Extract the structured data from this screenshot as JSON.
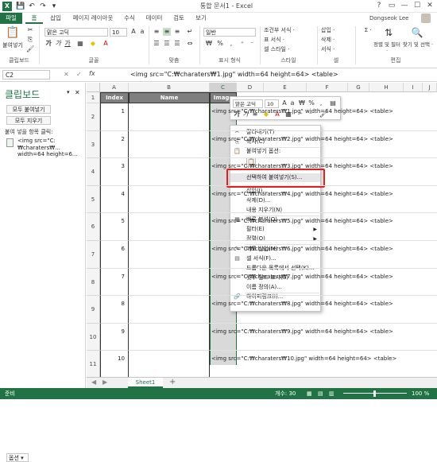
{
  "titlebar": {
    "app_icon": "X",
    "title": "통합 문서1 - Excel",
    "qat": [
      "save-icon",
      "undo-icon",
      "redo-icon",
      "customize-icon"
    ],
    "win": [
      "?",
      "▭",
      "—",
      "☐",
      "✕"
    ]
  },
  "tabs": [
    "파일",
    "홈",
    "삽입",
    "페이지 레이아웃",
    "수식",
    "데이터",
    "검토",
    "보기"
  ],
  "user": "Dongseok Lee",
  "ribbon": {
    "clipboard": {
      "paste": "붙여넣기",
      "label": "클립보드"
    },
    "font": {
      "name": "맑은 고딕",
      "size": "10",
      "label": "글꼴",
      "bold": "가",
      "italic": "가",
      "underline": "가"
    },
    "align": {
      "label": "맞춤"
    },
    "number": {
      "format": "일반",
      "label": "표시 형식",
      "percent": "%",
      "comma": ","
    },
    "style": {
      "cond": "조건부 서식 ·",
      "table": "표 서식 ·",
      "cell": "셀 스타일 ·",
      "label": "스타일"
    },
    "cells": {
      "insert": "삽입 ·",
      "delete": "삭제 ·",
      "format": "서식 ·",
      "label": "셀"
    },
    "edit": {
      "sum": "Σ ·",
      "sort": "정렬 및 필터 ·",
      "find": "찾기 및 선택 ·",
      "label": "편집"
    }
  },
  "formulabar": {
    "namebox": "C2",
    "fx": "fx",
    "text": "<img src=\"C:₩charaters₩1.jpg\" width=64 height=64> <table>"
  },
  "clipboard_pane": {
    "title": "클립보드",
    "paste_all": "모두 붙여넣기",
    "clear_all": "모두 지우기",
    "hint": "붙여 넣을 항목 클릭:",
    "item": "<img src=\"C:₩charaters₩... width=64 height=6...",
    "options": "옵션 ▾"
  },
  "grid": {
    "columns": [
      "A",
      "B",
      "C",
      "D",
      "E",
      "F",
      "G",
      "H",
      "I",
      "J"
    ],
    "header": {
      "index": "Index",
      "name": "Name",
      "image": "Image"
    },
    "rows": [
      {
        "row": "1"
      },
      {
        "row": "2",
        "index": "1",
        "text": "<img src=\"C:₩charaters₩1.jpg\" width=64 height=64> <table>"
      },
      {
        "row": "3",
        "index": "2",
        "text": "<img src=\"C:₩charaters₩2.jpg\" width=64 height=64> <table>"
      },
      {
        "row": "4",
        "index": "3",
        "text": "<img src=\"C:₩charaters₩3.jpg\" width=64 height=64> <table>"
      },
      {
        "row": "5",
        "index": "4",
        "text": "<img src=\"C:₩charaters₩4.jpg\" width=64 height=64> <table>"
      },
      {
        "row": "6",
        "index": "5",
        "text": "<img src=\"C:₩charaters₩5.jpg\" width=64 height=64> <table>"
      },
      {
        "row": "7",
        "index": "6",
        "text": "<img src=\"C:₩charaters₩6.jpg\" width=64 height=64> <table>"
      },
      {
        "row": "8",
        "index": "7",
        "text": "<img src=\"C:₩charaters₩7.jpg\" width=64 height=64> <table>"
      },
      {
        "row": "9",
        "index": "8",
        "text": "<img src=\"C:₩charaters₩8.jpg\" width=64 height=64> <table>"
      },
      {
        "row": "10",
        "index": "9",
        "text": "<img src=\"C:₩charaters₩9.jpg\" width=64 height=64> <table>"
      },
      {
        "row": "11",
        "index": "10",
        "text": "<img src=\"C:₩charaters₩10.jpg\" width=64 height=64> <table>"
      }
    ],
    "visible_tails": [
      "height=64> <table>",
      "height=64> <table>",
      "height=64> <table>",
      "height=64> <table>",
      "height=64> <table>",
      "height=64> <table>",
      "height=64> <table>"
    ]
  },
  "minibar": {
    "font": "맑은 고딕",
    "size": "10"
  },
  "context_menu": [
    {
      "label": "잘라내기(T)",
      "icon": "cut-icon",
      "ico": "✂"
    },
    {
      "label": "복사(C)",
      "icon": "copy-icon",
      "ico": "⎘"
    },
    {
      "label": "붙여넣기 옵션:",
      "icon": "paste-icon",
      "ico": "📋"
    },
    {
      "label": "",
      "icon": "paste-options-icon",
      "ico": ""
    },
    {
      "label": "선택하여 붙여넣기(S)...",
      "icon": "",
      "ico": ""
    },
    {
      "label": "삽입(I)...",
      "icon": "",
      "ico": ""
    },
    {
      "label": "삭제(D)...",
      "icon": "",
      "ico": ""
    },
    {
      "label": "내용 지우기(N)",
      "icon": "",
      "ico": ""
    },
    {
      "label": "빠른 분석(Q)",
      "icon": "quick-analysis-icon",
      "ico": "▦"
    },
    {
      "label": "필터(E)",
      "icon": "",
      "ico": "",
      "sub": true
    },
    {
      "label": "정렬(O)",
      "icon": "",
      "ico": "",
      "sub": true
    },
    {
      "label": "메모 삽입(M)",
      "icon": "comment-icon",
      "ico": "✎"
    },
    {
      "label": "셀 서식(F)...",
      "icon": "format-cells-icon",
      "ico": "▤"
    },
    {
      "label": "드롭다운 목록에서 선택(K)...",
      "icon": "",
      "ico": ""
    },
    {
      "label": "윗주 필드 표시(S)",
      "icon": "phonetic-icon",
      "ico": "ᵃ"
    },
    {
      "label": "이름 정의(A)...",
      "icon": "",
      "ico": ""
    },
    {
      "label": "하이퍼링크(I)...",
      "icon": "hyperlink-icon",
      "ico": "🔗"
    }
  ],
  "sheet": {
    "tab": "Sheet1",
    "add": "+"
  },
  "status": {
    "ready": "준비",
    "count": "개수: 30",
    "zoom": "100 %"
  },
  "colors": {
    "excel_green": "#217346",
    "header_gray": "#7f7f7f",
    "highlight_red": "#e02020"
  }
}
